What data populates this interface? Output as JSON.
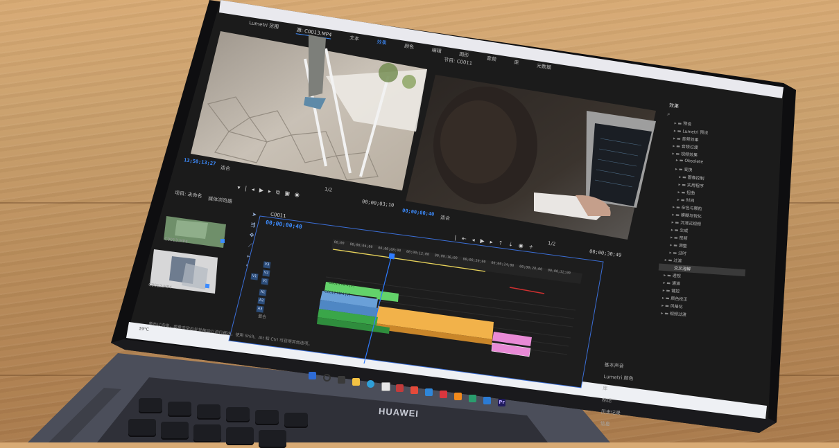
{
  "brand": "HUAWEI",
  "premiere": {
    "top_tabs": [
      "Lumetri 范围",
      "源: C0013.MP4",
      "文本",
      "效果",
      "颜色",
      "编辑",
      "图形",
      "音频",
      "库",
      "元数据"
    ],
    "source_timecode": "13;50;13;27",
    "source_fit": "适合",
    "source_fraction": "1/2",
    "source_duration": "00;00;03;10",
    "program_label": "节目: C0011",
    "program_timecode": "00;00;00;40",
    "program_fit": "适合",
    "program_fraction": "1/2",
    "program_duration": "00;00;30;49",
    "project_tabs": [
      "项目: 未命名",
      "媒体浏览器"
    ],
    "clip_names": [
      "C0013.MP4",
      "C0012.MP4"
    ],
    "sequence_tab": "C0011",
    "timeline_timecode": "00;00;00;40",
    "ruler_ticks": [
      "00;00",
      "00;00;04;00",
      "00;00;08;00",
      "00;00;12;00",
      "00;00;16;00",
      "00;00;20;00",
      "00;00;24;00",
      "00;00;28;00",
      "00;00;32;00"
    ],
    "tracks": [
      "V3",
      "V2",
      "V1",
      "A1",
      "A2",
      "A3"
    ],
    "track_mix_label": "混合",
    "clip_labels": [
      "C0013.MP4 [V]",
      "C0012.MP4 [V]"
    ],
    "status_text": "单击以选择，或单击空白处并拖动以进行框选。使用 Shift、Alt 和 Ctrl 可获得其他选项。",
    "effects_title": "效果",
    "effects_items": [
      "预设",
      "Lumetri 预设",
      "音频效果",
      "音频过渡",
      "视频效果",
      "Obsolete",
      "变换",
      "图像控制",
      "实用程序",
      "扭曲",
      "时间",
      "杂色与颗粒",
      "模糊与锐化",
      "沉浸式视频",
      "生成",
      "视频",
      "调整",
      "过时",
      "过渡",
      "透视",
      "通道",
      "键控",
      "颜色校正",
      "风格化",
      "视频过渡"
    ],
    "effects_selected": "交叉溶解",
    "essential_panel": [
      "基本声音",
      "Lumetri 颜色",
      "库",
      "标记",
      "历史记录",
      "信息"
    ],
    "essential_sub": "Lumetri 颜色"
  },
  "taskbar": {
    "time_hint": "19°C"
  },
  "colors": {
    "accent_blue": "#3d8cff",
    "clip_green": "#63d26a",
    "clip_blue": "#6aa0d8",
    "clip_orange": "#f2b24a",
    "clip_pink": "#e98ad6",
    "playhead": "#2e7bff"
  }
}
